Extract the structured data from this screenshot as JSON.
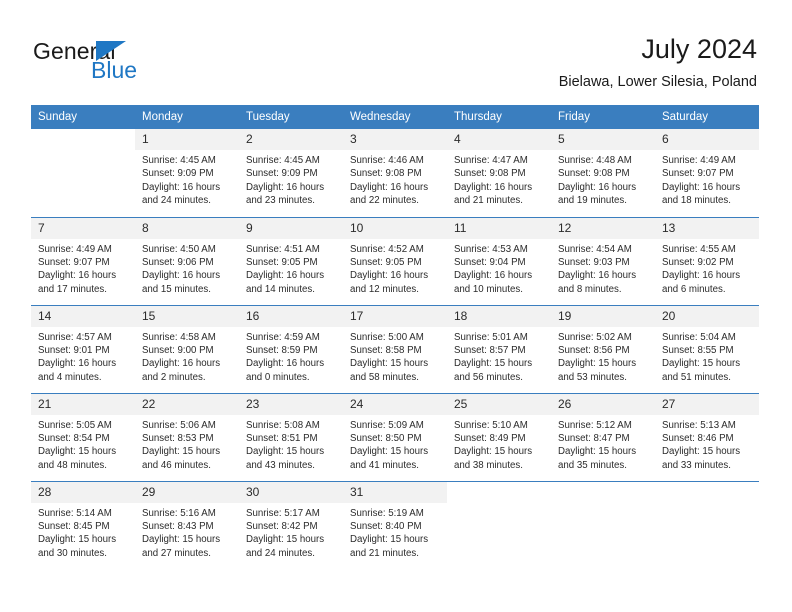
{
  "logo": {
    "word_top": "General",
    "word_bottom": "Blue",
    "triangle_color": "#1f77c4",
    "icon": "general-blue-logo"
  },
  "header": {
    "title": "July 2024",
    "subtitle": "Bielawa, Lower Silesia, Poland"
  },
  "theme": {
    "header_bg": "#3a7ebf",
    "header_text": "#ffffff",
    "daynum_bg": "#f2f2f2",
    "cell_bg": "#ffffff",
    "body_text": "#2b2b2b",
    "rule_color": "#3a7ebf"
  },
  "weekday_headers": [
    "Sunday",
    "Monday",
    "Tuesday",
    "Wednesday",
    "Thursday",
    "Friday",
    "Saturday"
  ],
  "weeks": [
    [
      {
        "empty": true,
        "day": "",
        "sunrise": "",
        "sunset": "",
        "daylight_1": "",
        "daylight_2": ""
      },
      {
        "empty": false,
        "day": "1",
        "sunrise": "Sunrise: 4:45 AM",
        "sunset": "Sunset: 9:09 PM",
        "daylight_1": "Daylight: 16 hours",
        "daylight_2": "and 24 minutes."
      },
      {
        "empty": false,
        "day": "2",
        "sunrise": "Sunrise: 4:45 AM",
        "sunset": "Sunset: 9:09 PM",
        "daylight_1": "Daylight: 16 hours",
        "daylight_2": "and 23 minutes."
      },
      {
        "empty": false,
        "day": "3",
        "sunrise": "Sunrise: 4:46 AM",
        "sunset": "Sunset: 9:08 PM",
        "daylight_1": "Daylight: 16 hours",
        "daylight_2": "and 22 minutes."
      },
      {
        "empty": false,
        "day": "4",
        "sunrise": "Sunrise: 4:47 AM",
        "sunset": "Sunset: 9:08 PM",
        "daylight_1": "Daylight: 16 hours",
        "daylight_2": "and 21 minutes."
      },
      {
        "empty": false,
        "day": "5",
        "sunrise": "Sunrise: 4:48 AM",
        "sunset": "Sunset: 9:08 PM",
        "daylight_1": "Daylight: 16 hours",
        "daylight_2": "and 19 minutes."
      },
      {
        "empty": false,
        "day": "6",
        "sunrise": "Sunrise: 4:49 AM",
        "sunset": "Sunset: 9:07 PM",
        "daylight_1": "Daylight: 16 hours",
        "daylight_2": "and 18 minutes."
      }
    ],
    [
      {
        "empty": false,
        "day": "7",
        "sunrise": "Sunrise: 4:49 AM",
        "sunset": "Sunset: 9:07 PM",
        "daylight_1": "Daylight: 16 hours",
        "daylight_2": "and 17 minutes."
      },
      {
        "empty": false,
        "day": "8",
        "sunrise": "Sunrise: 4:50 AM",
        "sunset": "Sunset: 9:06 PM",
        "daylight_1": "Daylight: 16 hours",
        "daylight_2": "and 15 minutes."
      },
      {
        "empty": false,
        "day": "9",
        "sunrise": "Sunrise: 4:51 AM",
        "sunset": "Sunset: 9:05 PM",
        "daylight_1": "Daylight: 16 hours",
        "daylight_2": "and 14 minutes."
      },
      {
        "empty": false,
        "day": "10",
        "sunrise": "Sunrise: 4:52 AM",
        "sunset": "Sunset: 9:05 PM",
        "daylight_1": "Daylight: 16 hours",
        "daylight_2": "and 12 minutes."
      },
      {
        "empty": false,
        "day": "11",
        "sunrise": "Sunrise: 4:53 AM",
        "sunset": "Sunset: 9:04 PM",
        "daylight_1": "Daylight: 16 hours",
        "daylight_2": "and 10 minutes."
      },
      {
        "empty": false,
        "day": "12",
        "sunrise": "Sunrise: 4:54 AM",
        "sunset": "Sunset: 9:03 PM",
        "daylight_1": "Daylight: 16 hours",
        "daylight_2": "and 8 minutes."
      },
      {
        "empty": false,
        "day": "13",
        "sunrise": "Sunrise: 4:55 AM",
        "sunset": "Sunset: 9:02 PM",
        "daylight_1": "Daylight: 16 hours",
        "daylight_2": "and 6 minutes."
      }
    ],
    [
      {
        "empty": false,
        "day": "14",
        "sunrise": "Sunrise: 4:57 AM",
        "sunset": "Sunset: 9:01 PM",
        "daylight_1": "Daylight: 16 hours",
        "daylight_2": "and 4 minutes."
      },
      {
        "empty": false,
        "day": "15",
        "sunrise": "Sunrise: 4:58 AM",
        "sunset": "Sunset: 9:00 PM",
        "daylight_1": "Daylight: 16 hours",
        "daylight_2": "and 2 minutes."
      },
      {
        "empty": false,
        "day": "16",
        "sunrise": "Sunrise: 4:59 AM",
        "sunset": "Sunset: 8:59 PM",
        "daylight_1": "Daylight: 16 hours",
        "daylight_2": "and 0 minutes."
      },
      {
        "empty": false,
        "day": "17",
        "sunrise": "Sunrise: 5:00 AM",
        "sunset": "Sunset: 8:58 PM",
        "daylight_1": "Daylight: 15 hours",
        "daylight_2": "and 58 minutes."
      },
      {
        "empty": false,
        "day": "18",
        "sunrise": "Sunrise: 5:01 AM",
        "sunset": "Sunset: 8:57 PM",
        "daylight_1": "Daylight: 15 hours",
        "daylight_2": "and 56 minutes."
      },
      {
        "empty": false,
        "day": "19",
        "sunrise": "Sunrise: 5:02 AM",
        "sunset": "Sunset: 8:56 PM",
        "daylight_1": "Daylight: 15 hours",
        "daylight_2": "and 53 minutes."
      },
      {
        "empty": false,
        "day": "20",
        "sunrise": "Sunrise: 5:04 AM",
        "sunset": "Sunset: 8:55 PM",
        "daylight_1": "Daylight: 15 hours",
        "daylight_2": "and 51 minutes."
      }
    ],
    [
      {
        "empty": false,
        "day": "21",
        "sunrise": "Sunrise: 5:05 AM",
        "sunset": "Sunset: 8:54 PM",
        "daylight_1": "Daylight: 15 hours",
        "daylight_2": "and 48 minutes."
      },
      {
        "empty": false,
        "day": "22",
        "sunrise": "Sunrise: 5:06 AM",
        "sunset": "Sunset: 8:53 PM",
        "daylight_1": "Daylight: 15 hours",
        "daylight_2": "and 46 minutes."
      },
      {
        "empty": false,
        "day": "23",
        "sunrise": "Sunrise: 5:08 AM",
        "sunset": "Sunset: 8:51 PM",
        "daylight_1": "Daylight: 15 hours",
        "daylight_2": "and 43 minutes."
      },
      {
        "empty": false,
        "day": "24",
        "sunrise": "Sunrise: 5:09 AM",
        "sunset": "Sunset: 8:50 PM",
        "daylight_1": "Daylight: 15 hours",
        "daylight_2": "and 41 minutes."
      },
      {
        "empty": false,
        "day": "25",
        "sunrise": "Sunrise: 5:10 AM",
        "sunset": "Sunset: 8:49 PM",
        "daylight_1": "Daylight: 15 hours",
        "daylight_2": "and 38 minutes."
      },
      {
        "empty": false,
        "day": "26",
        "sunrise": "Sunrise: 5:12 AM",
        "sunset": "Sunset: 8:47 PM",
        "daylight_1": "Daylight: 15 hours",
        "daylight_2": "and 35 minutes."
      },
      {
        "empty": false,
        "day": "27",
        "sunrise": "Sunrise: 5:13 AM",
        "sunset": "Sunset: 8:46 PM",
        "daylight_1": "Daylight: 15 hours",
        "daylight_2": "and 33 minutes."
      }
    ],
    [
      {
        "empty": false,
        "day": "28",
        "sunrise": "Sunrise: 5:14 AM",
        "sunset": "Sunset: 8:45 PM",
        "daylight_1": "Daylight: 15 hours",
        "daylight_2": "and 30 minutes."
      },
      {
        "empty": false,
        "day": "29",
        "sunrise": "Sunrise: 5:16 AM",
        "sunset": "Sunset: 8:43 PM",
        "daylight_1": "Daylight: 15 hours",
        "daylight_2": "and 27 minutes."
      },
      {
        "empty": false,
        "day": "30",
        "sunrise": "Sunrise: 5:17 AM",
        "sunset": "Sunset: 8:42 PM",
        "daylight_1": "Daylight: 15 hours",
        "daylight_2": "and 24 minutes."
      },
      {
        "empty": false,
        "day": "31",
        "sunrise": "Sunrise: 5:19 AM",
        "sunset": "Sunset: 8:40 PM",
        "daylight_1": "Daylight: 15 hours",
        "daylight_2": "and 21 minutes."
      },
      {
        "empty": true,
        "day": "",
        "sunrise": "",
        "sunset": "",
        "daylight_1": "",
        "daylight_2": ""
      },
      {
        "empty": true,
        "day": "",
        "sunrise": "",
        "sunset": "",
        "daylight_1": "",
        "daylight_2": ""
      },
      {
        "empty": true,
        "day": "",
        "sunrise": "",
        "sunset": "",
        "daylight_1": "",
        "daylight_2": ""
      }
    ]
  ]
}
